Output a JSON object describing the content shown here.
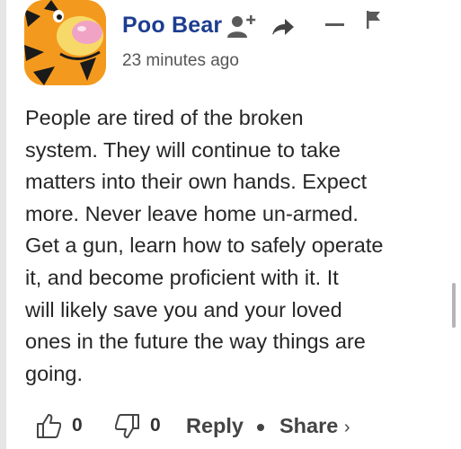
{
  "comment": {
    "author": "Poo Bear",
    "time": "23 minutes ago",
    "lines": [
      "People are tired of the broken",
      "system. They will continue to take",
      "matters into their own hands. Expect",
      "more. Never leave home un-armed.",
      "Get a gun, learn how to safely operate",
      "it, and become proficient with it. It",
      "will likely save you and your loved",
      "ones in the future the way things are",
      "going."
    ]
  },
  "actions": {
    "like_count": "0",
    "dislike_count": "0",
    "reply_label": "Reply",
    "share_label": "Share",
    "share_chevron": "›"
  },
  "icons": {
    "follow": "add-person-icon",
    "share": "share-arrow-icon",
    "collapse": "minus-icon",
    "report": "flag-icon",
    "like": "thumbs-up-icon",
    "dislike": "thumbs-down-icon"
  },
  "colors": {
    "author": "#1c3d8f",
    "avatar_orange": "#f39a1e",
    "avatar_pink_nose": "#f0a3c4"
  }
}
